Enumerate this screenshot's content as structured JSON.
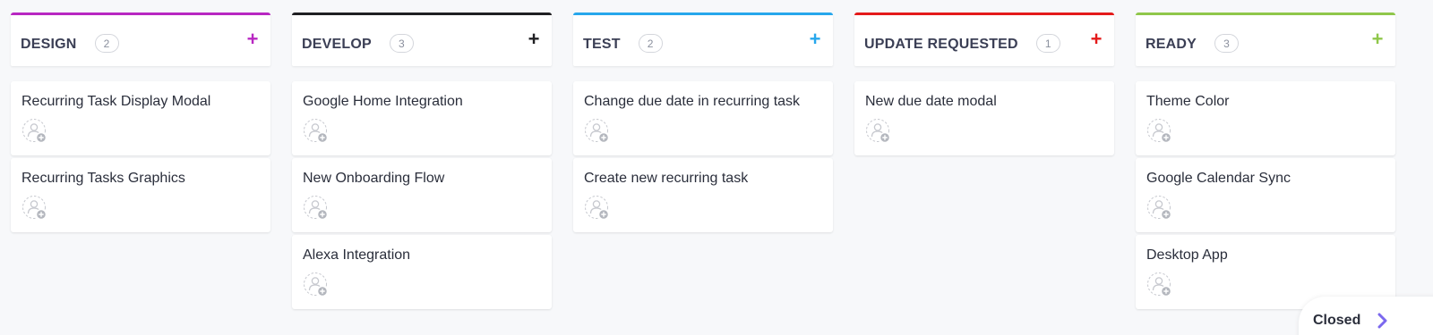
{
  "board": {
    "columns": [
      {
        "title": "DESIGN",
        "count": "2",
        "color": "#b827c2",
        "cards": [
          {
            "title": "Recurring Task Display Modal"
          },
          {
            "title": "Recurring Tasks Graphics"
          }
        ]
      },
      {
        "title": "DEVELOP",
        "count": "3",
        "color": "#1f1f22",
        "cards": [
          {
            "title": "Google Home Integration"
          },
          {
            "title": "New Onboarding Flow"
          },
          {
            "title": "Alexa Integration"
          }
        ]
      },
      {
        "title": "TEST",
        "count": "2",
        "color": "#27a7ec",
        "cards": [
          {
            "title": "Change due date in recurring task"
          },
          {
            "title": "Create new recurring task"
          }
        ]
      },
      {
        "title": "UPDATE REQUESTED",
        "count": "1",
        "color": "#e41a1a",
        "cards": [
          {
            "title": "New due date modal"
          }
        ]
      },
      {
        "title": "READY",
        "count": "3",
        "color": "#8fc74a",
        "cards": [
          {
            "title": "Theme Color"
          },
          {
            "title": "Google Calendar Sync"
          },
          {
            "title": "Desktop App"
          }
        ]
      }
    ],
    "add_icon": "plus-icon",
    "assign_icon": "add-assignee-icon"
  },
  "closed": {
    "label": "Closed",
    "icon": "chevron-right-icon",
    "icon_color": "#7b68ee"
  }
}
